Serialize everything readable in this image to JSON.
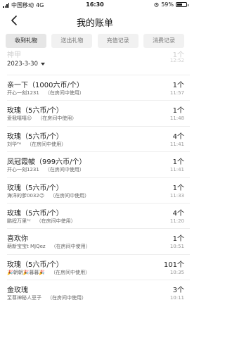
{
  "status": {
    "carrier": "中国移动",
    "network": "4G",
    "time": "16:30",
    "battery": "59%",
    "battery_level": 0.59
  },
  "nav": {
    "title": "我的账单"
  },
  "tabs": [
    {
      "label": "收到礼物",
      "active": true
    },
    {
      "label": "送出礼物",
      "active": false
    },
    {
      "label": "充值记录",
      "active": false
    },
    {
      "label": "消费记录",
      "active": false
    }
  ],
  "partial": {
    "title": "神甲",
    "count": "1个",
    "time": "12:52"
  },
  "date_filter": {
    "value": "2023-3-30"
  },
  "records": [
    {
      "title": "亲一下（1000六币/个）",
      "user": "开心一刻1231",
      "note": "（在房间中使用）",
      "count": "1个",
      "time": "11:57"
    },
    {
      "title": "玫瑰（5六币/个）",
      "user": "爱我嘻嘻☺",
      "note": "（在房间中使用）",
      "count": "1个",
      "time": "11:48"
    },
    {
      "title": "玫瑰（5六币/个）",
      "user": "刘华ᴾ*",
      "note": "（在房间中使用）",
      "count": "4个",
      "time": "11:41"
    },
    {
      "title": "凤冠霞帔（999六币/个）",
      "user": "开心一刻1231",
      "note": "（在房间中使用）",
      "count": "1个",
      "time": "11:41"
    },
    {
      "title": "玫瑰（5六币/个）",
      "user": "海洋的爹0032☺",
      "note": "（在房间中使用）",
      "count": "1个",
      "time": "11:33"
    },
    {
      "title": "玫瑰（5六币/个）",
      "user": "鹏程万里ᵇᵞ",
      "note": "（在房间中使用）",
      "count": "4个",
      "time": "11:20"
    },
    {
      "title": "喜欢你",
      "user": "萌新宝宝t MJQez",
      "note": "（在房间中使用）",
      "count": "1个",
      "time": "10:51"
    },
    {
      "title": "玫瑰（5六币/个）",
      "user": "🎉朝朝🎉暮暮🎉",
      "note": "（在房间中使用）",
      "count": "101个",
      "time": "10:35"
    },
    {
      "title": "金玫瑰",
      "user": "至尊神秘人豆子",
      "note": "（在房间中使用）",
      "count": "3个",
      "time": "10:11"
    }
  ]
}
